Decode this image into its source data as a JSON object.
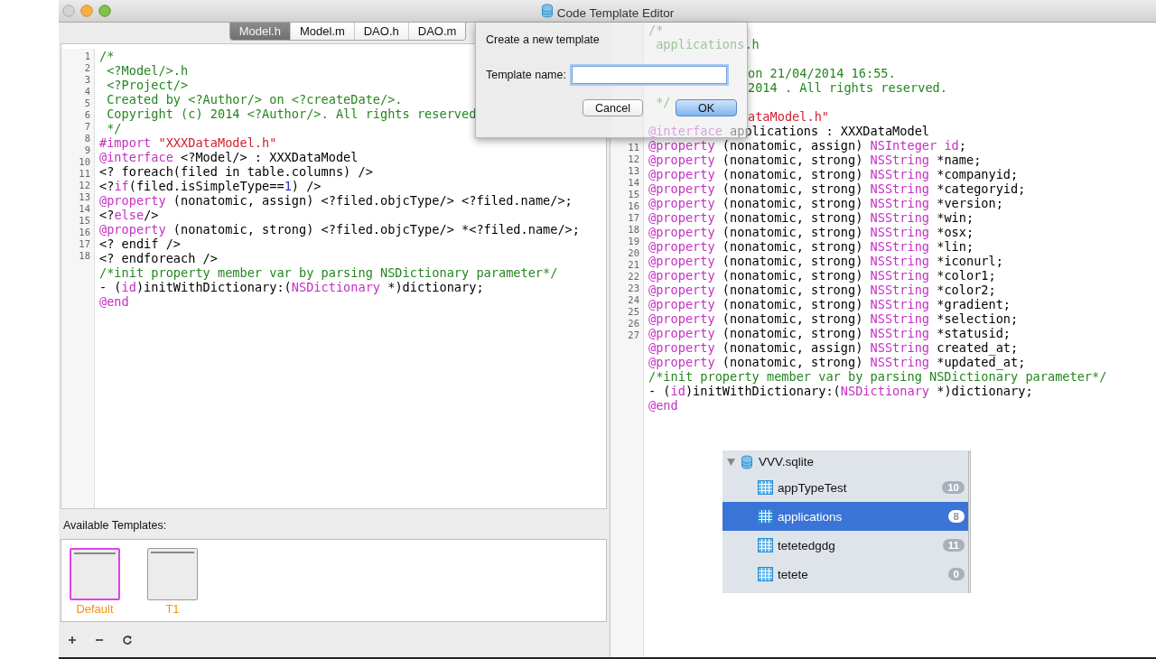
{
  "window": {
    "title": "Code Template Editor"
  },
  "tabs": [
    {
      "label": "Model.h",
      "selected": true
    },
    {
      "label": "Model.m",
      "selected": false
    },
    {
      "label": "DAO.h",
      "selected": false
    },
    {
      "label": "DAO.m",
      "selected": false
    }
  ],
  "template_editor": {
    "line_numbers": [
      "1",
      "2",
      "3",
      "4",
      "5",
      "6",
      "7",
      "8",
      "9",
      "10",
      "11",
      "12",
      "13",
      "14",
      "15",
      "16",
      "17",
      "18"
    ],
    "lines": [
      {
        "segments": [
          {
            "kind": "comment",
            "text": "/*"
          }
        ]
      },
      {
        "segments": [
          {
            "kind": "comment",
            "text": " <?Model/>.h"
          }
        ]
      },
      {
        "segments": [
          {
            "kind": "comment",
            "text": " <?Project/>"
          }
        ]
      },
      {
        "segments": [
          {
            "kind": "comment",
            "text": " Created by <?Author/> on <?createDate/>."
          }
        ]
      },
      {
        "segments": [
          {
            "kind": "comment",
            "text": " Copyright (c) 2014 <?Author/>. All rights reserved"
          }
        ]
      },
      {
        "segments": [
          {
            "kind": "comment",
            "text": " */"
          }
        ]
      },
      {
        "segments": [
          {
            "kind": "keyword",
            "text": "#import"
          },
          {
            "kind": "string",
            "text": " \"XXXDataModel.h\""
          }
        ]
      },
      {
        "segments": [
          {
            "kind": "keyword",
            "text": "@interface"
          },
          {
            "kind": "plain",
            "text": " <?Model/> : XXXDataModel"
          }
        ]
      },
      {
        "segments": [
          {
            "kind": "plain",
            "text": "<? foreach(filed in table.columns) />"
          }
        ]
      },
      {
        "segments": [
          {
            "kind": "plain",
            "text": "<?"
          },
          {
            "kind": "keyword",
            "text": "if"
          },
          {
            "kind": "plain",
            "text": "(filed.isSimpleType=="
          },
          {
            "kind": "number",
            "text": "1"
          },
          {
            "kind": "plain",
            "text": ") />"
          }
        ]
      },
      {
        "segments": [
          {
            "kind": "keyword",
            "text": "@property"
          },
          {
            "kind": "plain",
            "text": " (nonatomic, assign) <?filed.objcType/> <?filed.name/>;"
          }
        ]
      },
      {
        "segments": [
          {
            "kind": "plain",
            "text": "<?"
          },
          {
            "kind": "keyword",
            "text": "else"
          },
          {
            "kind": "plain",
            "text": "/>"
          }
        ]
      },
      {
        "segments": [
          {
            "kind": "keyword",
            "text": "@property"
          },
          {
            "kind": "plain",
            "text": " (nonatomic, strong) <?filed.objcType/> *<?filed.name/>;"
          }
        ]
      },
      {
        "segments": [
          {
            "kind": "plain",
            "text": "<? endif />"
          }
        ]
      },
      {
        "segments": [
          {
            "kind": "plain",
            "text": "<? endforeach />"
          }
        ]
      },
      {
        "segments": [
          {
            "kind": "comment",
            "text": "/*init property member var by parsing NSDictionary parameter*/"
          }
        ]
      },
      {
        "segments": [
          {
            "kind": "plain",
            "text": "- ("
          },
          {
            "kind": "keyword",
            "text": "id"
          },
          {
            "kind": "plain",
            "text": ")initWithDictionary:("
          },
          {
            "kind": "keyword",
            "text": "NSDictionary"
          },
          {
            "kind": "plain",
            "text": " *)dictionary;"
          }
        ]
      },
      {
        "segments": [
          {
            "kind": "keyword",
            "text": "@end"
          }
        ]
      }
    ]
  },
  "available_templates": {
    "label": "Available Templates:",
    "items": [
      {
        "name": "Default",
        "selected": true
      },
      {
        "name": "T1",
        "selected": false
      }
    ]
  },
  "preview_editor": {
    "line_numbers": [
      "11",
      "12",
      "13",
      "14",
      "15",
      "16",
      "17",
      "18",
      "19",
      "20",
      "21",
      "22",
      "23",
      "24",
      "25",
      "26",
      "27"
    ],
    "lines": [
      {
        "covered": false,
        "segments": [
          {
            "kind": "comment",
            "text": "/*"
          }
        ]
      },
      {
        "covered": false,
        "segments": [
          {
            "kind": "comment",
            "text": " applications.h"
          }
        ]
      },
      {
        "kind": "blank"
      },
      {
        "covered": true,
        "segments": [
          {
            "kind": "comment",
            "text": "on 21/04/2014 16:55."
          }
        ]
      },
      {
        "covered": true,
        "segments": [
          {
            "kind": "comment",
            "text": "2014 . All rights reserved."
          }
        ]
      },
      {
        "covered": false,
        "segments": [
          {
            "kind": "comment",
            "text": " */"
          }
        ]
      },
      {
        "covered": true,
        "segments": [
          {
            "kind": "string",
            "text": "ataModel.h\""
          }
        ]
      },
      {
        "covered": false,
        "segments": [
          {
            "kind": "keyword",
            "text": "@interface"
          },
          {
            "kind": "plain",
            "text": " applications : XXXDataModel"
          }
        ]
      },
      {
        "covered": false,
        "segments": [
          {
            "kind": "keyword",
            "text": "@property"
          },
          {
            "kind": "plain",
            "text": " (nonatomic, assign) "
          },
          {
            "kind": "keyword",
            "text": "NSInteger id"
          },
          {
            "kind": "plain",
            "text": ";"
          }
        ]
      },
      {
        "covered": false,
        "segments": [
          {
            "kind": "keyword",
            "text": "@property"
          },
          {
            "kind": "plain",
            "text": " (nonatomic, strong) "
          },
          {
            "kind": "keyword",
            "text": "NSString"
          },
          {
            "kind": "plain",
            "text": " *name;"
          }
        ]
      },
      {
        "covered": false,
        "segments": [
          {
            "kind": "keyword",
            "text": "@property"
          },
          {
            "kind": "plain",
            "text": " (nonatomic, strong) "
          },
          {
            "kind": "keyword",
            "text": "NSString"
          },
          {
            "kind": "plain",
            "text": " *companyid;"
          }
        ]
      },
      {
        "covered": false,
        "segments": [
          {
            "kind": "keyword",
            "text": "@property"
          },
          {
            "kind": "plain",
            "text": " (nonatomic, strong) "
          },
          {
            "kind": "keyword",
            "text": "NSString"
          },
          {
            "kind": "plain",
            "text": " *categoryid;"
          }
        ]
      },
      {
        "covered": false,
        "segments": [
          {
            "kind": "keyword",
            "text": "@property"
          },
          {
            "kind": "plain",
            "text": " (nonatomic, strong) "
          },
          {
            "kind": "keyword",
            "text": "NSString"
          },
          {
            "kind": "plain",
            "text": " *version;"
          }
        ]
      },
      {
        "covered": false,
        "segments": [
          {
            "kind": "keyword",
            "text": "@property"
          },
          {
            "kind": "plain",
            "text": " (nonatomic, strong) "
          },
          {
            "kind": "keyword",
            "text": "NSString"
          },
          {
            "kind": "plain",
            "text": " *win;"
          }
        ]
      },
      {
        "covered": false,
        "segments": [
          {
            "kind": "keyword",
            "text": "@property"
          },
          {
            "kind": "plain",
            "text": " (nonatomic, strong) "
          },
          {
            "kind": "keyword",
            "text": "NSString"
          },
          {
            "kind": "plain",
            "text": " *osx;"
          }
        ]
      },
      {
        "covered": false,
        "segments": [
          {
            "kind": "keyword",
            "text": "@property"
          },
          {
            "kind": "plain",
            "text": " (nonatomic, strong) "
          },
          {
            "kind": "keyword",
            "text": "NSString"
          },
          {
            "kind": "plain",
            "text": " *lin;"
          }
        ]
      },
      {
        "covered": false,
        "segments": [
          {
            "kind": "keyword",
            "text": "@property"
          },
          {
            "kind": "plain",
            "text": " (nonatomic, strong) "
          },
          {
            "kind": "keyword",
            "text": "NSString"
          },
          {
            "kind": "plain",
            "text": " *iconurl;"
          }
        ]
      },
      {
        "covered": false,
        "segments": [
          {
            "kind": "keyword",
            "text": "@property"
          },
          {
            "kind": "plain",
            "text": " (nonatomic, strong) "
          },
          {
            "kind": "keyword",
            "text": "NSString"
          },
          {
            "kind": "plain",
            "text": " *color1;"
          }
        ]
      },
      {
        "covered": false,
        "segments": [
          {
            "kind": "keyword",
            "text": "@property"
          },
          {
            "kind": "plain",
            "text": " (nonatomic, strong) "
          },
          {
            "kind": "keyword",
            "text": "NSString"
          },
          {
            "kind": "plain",
            "text": " *color2;"
          }
        ]
      },
      {
        "covered": false,
        "segments": [
          {
            "kind": "keyword",
            "text": "@property"
          },
          {
            "kind": "plain",
            "text": " (nonatomic, strong) "
          },
          {
            "kind": "keyword",
            "text": "NSString"
          },
          {
            "kind": "plain",
            "text": " *gradient;"
          }
        ]
      },
      {
        "covered": false,
        "segments": [
          {
            "kind": "keyword",
            "text": "@property"
          },
          {
            "kind": "plain",
            "text": " (nonatomic, strong) "
          },
          {
            "kind": "keyword",
            "text": "NSString"
          },
          {
            "kind": "plain",
            "text": " *selection;"
          }
        ]
      },
      {
        "covered": false,
        "segments": [
          {
            "kind": "keyword",
            "text": "@property"
          },
          {
            "kind": "plain",
            "text": " (nonatomic, strong) "
          },
          {
            "kind": "keyword",
            "text": "NSString"
          },
          {
            "kind": "plain",
            "text": " *statusid;"
          }
        ]
      },
      {
        "covered": false,
        "segments": [
          {
            "kind": "keyword",
            "text": "@property"
          },
          {
            "kind": "plain",
            "text": " (nonatomic, assign) "
          },
          {
            "kind": "keyword",
            "text": "NSString"
          },
          {
            "kind": "plain",
            "text": " created_at;"
          }
        ]
      },
      {
        "covered": false,
        "segments": [
          {
            "kind": "keyword",
            "text": "@property"
          },
          {
            "kind": "plain",
            "text": " (nonatomic, strong) "
          },
          {
            "kind": "keyword",
            "text": "NSString"
          },
          {
            "kind": "plain",
            "text": " *updated_at;"
          }
        ]
      },
      {
        "covered": false,
        "segments": [
          {
            "kind": "comment",
            "text": "/*init property member var by parsing NSDictionary parameter*/"
          }
        ]
      },
      {
        "covered": false,
        "segments": [
          {
            "kind": "plain",
            "text": "- ("
          },
          {
            "kind": "keyword",
            "text": "id"
          },
          {
            "kind": "plain",
            "text": ")initWithDictionary:("
          },
          {
            "kind": "keyword",
            "text": "NSDictionary"
          },
          {
            "kind": "plain",
            "text": " *)dictionary;"
          }
        ]
      },
      {
        "covered": false,
        "segments": [
          {
            "kind": "keyword",
            "text": "@end"
          }
        ]
      }
    ]
  },
  "database_list": {
    "database": {
      "name": "VVV.sqlite",
      "expanded": true
    },
    "tables": [
      {
        "name": "appTypeTest",
        "count": "10",
        "selected": false
      },
      {
        "name": "applications",
        "count": "8",
        "selected": true
      },
      {
        "name": "tetetedgdg",
        "count": "11",
        "selected": false
      },
      {
        "name": "tetete",
        "count": "0",
        "selected": false
      }
    ]
  },
  "dialog": {
    "title": "Create a new template",
    "field_label": "Template name:",
    "buttons": [
      {
        "label": "Cancel",
        "kind": "secondary"
      },
      {
        "label": "OK",
        "kind": "default"
      }
    ]
  }
}
